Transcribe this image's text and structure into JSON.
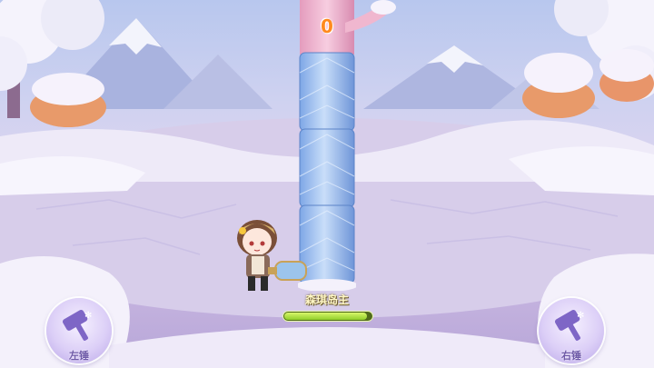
{
  "game": {
    "score": "0",
    "player_name": "森琪岛主",
    "hp_fraction": 0.95
  },
  "controls": {
    "left_label": "左锤",
    "right_label": "右锤",
    "left_icon": "hammer-icon",
    "right_icon": "hammer-icon"
  },
  "colors": {
    "score": "#ff8a1e",
    "hp_fill": "#a6dc3c",
    "pillar_ice": "#9fc4f0",
    "pillar_top_pink": "#f0b7cf"
  }
}
